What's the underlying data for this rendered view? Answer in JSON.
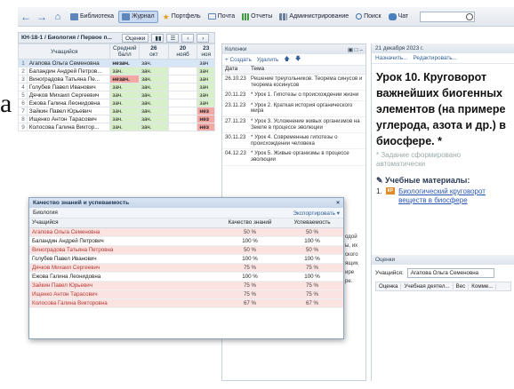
{
  "toolbar": {
    "items": [
      {
        "label": "Библиотека",
        "active": false,
        "icon": "library-icon"
      },
      {
        "label": "Журнал",
        "active": true,
        "icon": "journal-icon"
      },
      {
        "label": "Портфель",
        "active": false,
        "icon": "star-icon"
      },
      {
        "label": "Почта",
        "active": false,
        "icon": "mail-icon"
      },
      {
        "label": "Отчеты",
        "active": false,
        "icon": "reports-icon"
      },
      {
        "label": "Администрирование",
        "active": false,
        "icon": "admin-icon"
      },
      {
        "label": "Поиск",
        "active": false,
        "icon": "search-icon"
      },
      {
        "label": "Чат",
        "active": false,
        "icon": "chat-icon"
      }
    ]
  },
  "side_letter": "а",
  "journal": {
    "title": "КН-18-1 / Биология / Первое п...",
    "grades_button": "Оценки",
    "columns": {
      "student": "Учащийся",
      "avg": "Средний балл",
      "c1_day": "26",
      "c1_month": "окт",
      "c2_day": "20",
      "c2_month": "нояб",
      "c3_day": "23",
      "c3_month": "ноя"
    },
    "rows": [
      {
        "num": "1",
        "name": "Агапова Ольга Семеновна",
        "avg": "незач.",
        "c1": "зач.",
        "c3": "зач",
        "selected": true,
        "avg_bad": true
      },
      {
        "num": "2",
        "name": "Баландин Андрей Петров...",
        "avg": "зач.",
        "c1": "зач.",
        "c3": "зач",
        "selected": false,
        "avg_bad": false
      },
      {
        "num": "3",
        "name": "Виноградова Татьяна Пе...",
        "avg": "незач.",
        "c1": "зач.",
        "c3": "зач",
        "selected": false,
        "avg_bad": true
      },
      {
        "num": "4",
        "name": "Голубев Павел Иванович",
        "avg": "зач.",
        "c1": "зач.",
        "c3": "зач",
        "selected": false,
        "avg_bad": false
      },
      {
        "num": "5",
        "name": "Дячков Михаил Сергеевич",
        "avg": "зач.",
        "c1": "зач.",
        "c3": "зач",
        "selected": false,
        "avg_bad": false
      },
      {
        "num": "6",
        "name": "Ежова Галина Леонидовна",
        "avg": "зач.",
        "c1": "зач.",
        "c3": "зач",
        "selected": false,
        "avg_bad": false
      },
      {
        "num": "7",
        "name": "Зайкин Павел Юрьевич",
        "avg": "зач.",
        "c1": "зач.",
        "c3": "нез",
        "selected": false,
        "avg_bad": false
      },
      {
        "num": "8",
        "name": "Ищенко Антон Тарасович",
        "avg": "зач.",
        "c1": "зач.",
        "c3": "нез",
        "selected": false,
        "avg_bad": false
      },
      {
        "num": "9",
        "name": "Колосова Галина Виктор...",
        "avg": "зач.",
        "c1": "зач.",
        "c3": "нез",
        "selected": false,
        "avg_bad": false
      }
    ]
  },
  "lessons": {
    "header": "Колонки",
    "create": "+ Создать",
    "delete": "Удалить",
    "col_date": "Дата",
    "col_topic": "Тема",
    "rows": [
      {
        "date": "26.10.23",
        "topic": "Решение треугольников. Теорема синусов и теорема косинусов"
      },
      {
        "date": "20.11.23",
        "topic": "* Урок 1. Гипотезы о происхождении жизни"
      },
      {
        "date": "23.11.23",
        "topic": "* Урок 2. Краткая история органического мира"
      },
      {
        "date": "27.11.23",
        "topic": "* Урок 3. Усложнение живых организмов на Земле в процессе эволюции"
      },
      {
        "date": "30.11.23",
        "topic": "* Урок 4. Современные гипотезы о происхождении человека"
      },
      {
        "date": "04.12.23",
        "topic": "* Урок 5. Живые организмы в процессе эволюции"
      }
    ],
    "peek": [
      "одой",
      "ы, их",
      "ского",
      "ящих",
      "ире",
      "ре."
    ]
  },
  "lesson_panel": {
    "date": "21 декабря 2023 г.",
    "assign": "Назначить...",
    "edit": "Редактировать...",
    "title": "Урок 10. Круговорот важнейших биогенных элементов (на примере углерода, азота и др.) в биосфере. *",
    "note": "* Задание сформировано автоматически",
    "materials_head": "Учебные материалы:",
    "material_num": "1.",
    "material_badge": "КР",
    "material_link": "Биологический круговорот веществ в биосфере",
    "grades_head": "Оценки",
    "student_label": "Учащийся:",
    "student_value": "Агапова Ольга Семеновна",
    "cols": [
      "Оценка",
      "Учебная деятел...",
      "Вес",
      "Комме..."
    ]
  },
  "quality": {
    "title": "Качество знаний и успеваемость",
    "subject": "Биология",
    "export": "Экспортировать",
    "col_student": "Учащийся",
    "col_quality": "Качество знаний",
    "col_progress": "Успеваемость",
    "rows": [
      {
        "name": "Агапова Ольга Семеновна",
        "q": "50 %",
        "p": "50 %",
        "warn": true
      },
      {
        "name": "Баландин Андрей Петрович",
        "q": "100 %",
        "p": "100 %",
        "warn": false
      },
      {
        "name": "Виноградова Татьяна Петровна",
        "q": "50 %",
        "p": "50 %",
        "warn": true
      },
      {
        "name": "Голубев Павел Иванович",
        "q": "100 %",
        "p": "100 %",
        "warn": false
      },
      {
        "name": "Дячков Михаил Сергеевич",
        "q": "75 %",
        "p": "75 %",
        "warn": true
      },
      {
        "name": "Ежова Галина Леонидовна",
        "q": "100 %",
        "p": "100 %",
        "warn": false
      },
      {
        "name": "Зайкин Павел Юрьевич",
        "q": "75 %",
        "p": "75 %",
        "warn": true
      },
      {
        "name": "Ищенко Антон Тарасович",
        "q": "75 %",
        "p": "75 %",
        "warn": true
      },
      {
        "name": "Колосова Галина Викторовна",
        "q": "67 %",
        "p": "67 %",
        "warn": true
      }
    ]
  }
}
